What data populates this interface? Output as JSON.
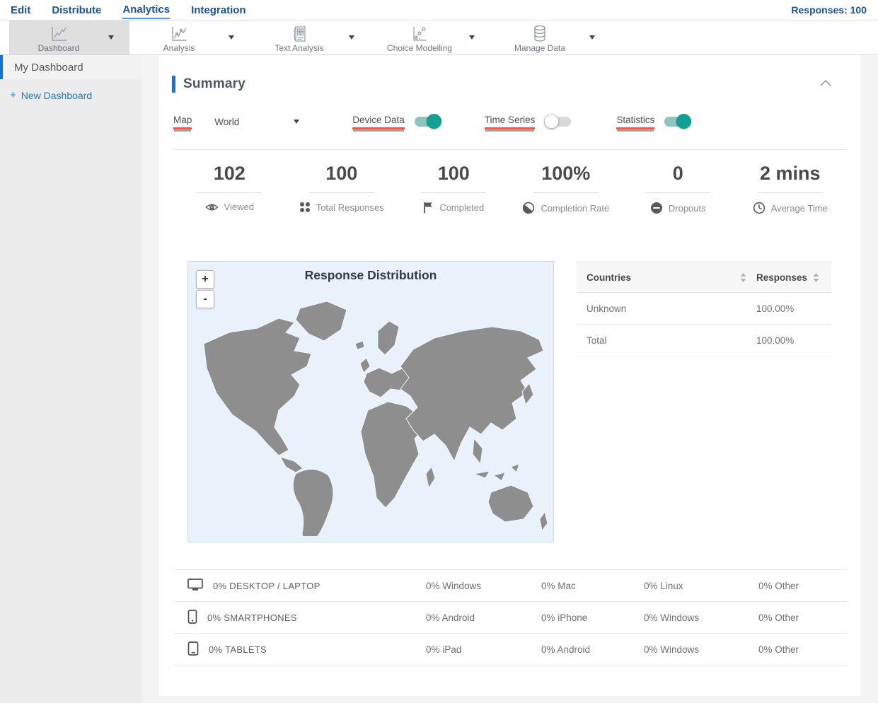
{
  "nav": {
    "items": [
      {
        "label": "Edit"
      },
      {
        "label": "Distribute"
      },
      {
        "label": "Analytics"
      },
      {
        "label": "Integration"
      }
    ],
    "responses": "Responses: 100"
  },
  "toolbar": {
    "items": [
      {
        "label": "Dashboard",
        "icon": "line-chart-icon",
        "selected": true
      },
      {
        "label": "Analysis",
        "icon": "line-chart-icon",
        "selected": false
      },
      {
        "label": "Text Analysis",
        "icon": "document-grid-icon",
        "selected": false
      },
      {
        "label": "Choice Modelling",
        "icon": "scatter-chart-icon",
        "selected": false
      },
      {
        "label": "Manage Data",
        "icon": "database-icon",
        "selected": false
      }
    ]
  },
  "sidebar": {
    "items": [
      {
        "label": "My Dashboard",
        "selected": true
      }
    ],
    "plus": "+",
    "new_dashboard": "New Dashboard"
  },
  "summary": {
    "title": "Summary"
  },
  "controls": {
    "map_label": "Map",
    "map_value": "World",
    "device_data_label": "Device Data",
    "device_data_on": true,
    "time_series_label": "Time Series",
    "time_series_on": false,
    "statistics_label": "Statistics",
    "statistics_on": true
  },
  "stats": [
    {
      "value": "102",
      "label": "Viewed",
      "icon": "eye-icon"
    },
    {
      "value": "100",
      "label": "Total Responses",
      "icon": "grid-dots-icon"
    },
    {
      "value": "100",
      "label": "Completed",
      "icon": "flag-icon"
    },
    {
      "value": "100%",
      "label": "Completion Rate",
      "icon": "contrast-icon"
    },
    {
      "value": "0",
      "label": "Dropouts",
      "icon": "minus-circle-icon"
    },
    {
      "value": "2 mins",
      "label": "Average Time",
      "icon": "clock-icon"
    }
  ],
  "map": {
    "title": "Response Distribution",
    "zoom_in": "+",
    "zoom_out": "-"
  },
  "countries_table": {
    "headers": [
      "Countries",
      "Responses"
    ],
    "rows": [
      {
        "country": "Unknown",
        "responses": "100.00%"
      },
      {
        "country": "Total",
        "responses": "100.00%"
      }
    ]
  },
  "devices": {
    "rows": [
      {
        "icon": "desktop-icon",
        "label": "0% DESKTOP / LAPTOP",
        "details": [
          "0% Windows",
          "0% Mac",
          "0% Linux",
          "0% Other"
        ]
      },
      {
        "icon": "smartphone-icon",
        "label": "0% SMARTPHONES",
        "details": [
          "0% Android",
          "0% iPhone",
          "0% Windows",
          "0% Other"
        ]
      },
      {
        "icon": "tablet-icon",
        "label": "0% TABLETS",
        "details": [
          "0% iPad",
          "0% Android",
          "0% Windows",
          "0% Other"
        ]
      }
    ]
  },
  "colors": {
    "nav_blue": "#1a539c",
    "active_underline": "#44a0e8",
    "accent_bar_blue": "#1673d2",
    "toggle_on": "#12a096",
    "red_underline": "#e8604d",
    "map_bg": "#e9f2fa",
    "map_land": "#8e8e8e"
  }
}
